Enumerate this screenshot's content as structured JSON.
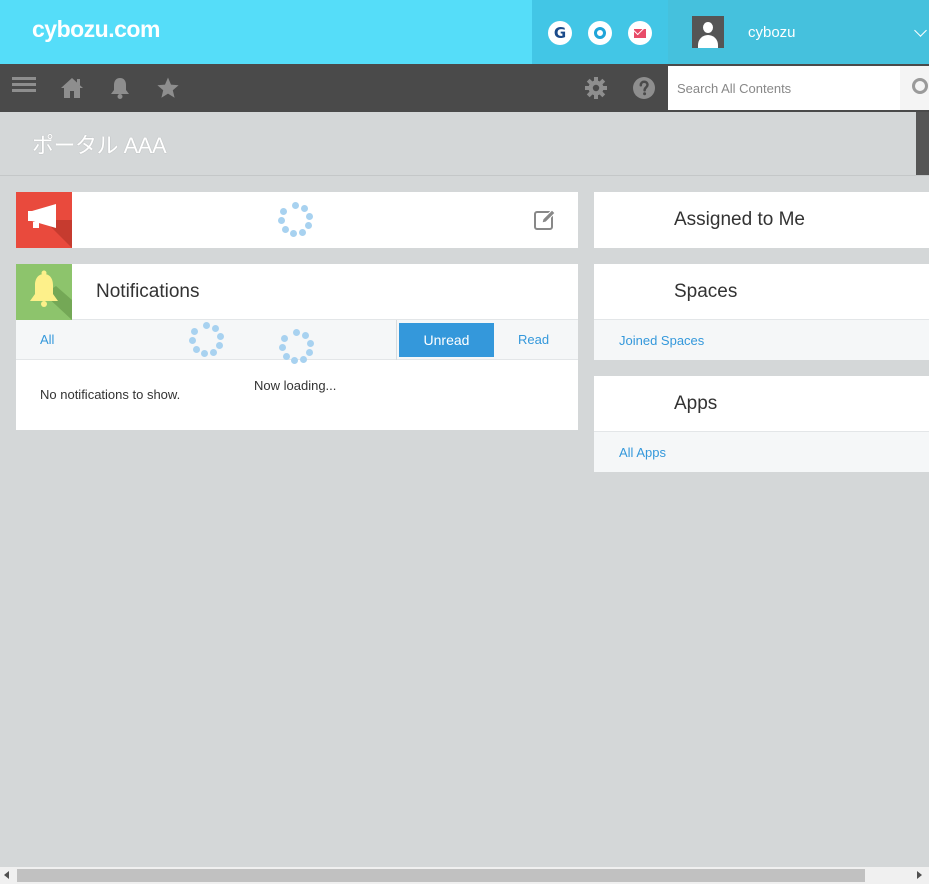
{
  "header": {
    "logo": "cybozu.com",
    "services": [
      {
        "name": "garoon",
        "letter": "G"
      },
      {
        "name": "office",
        "letter": ""
      },
      {
        "name": "mailwise",
        "letter": ""
      }
    ],
    "username": "cybozu"
  },
  "nav": {
    "search_placeholder": "Search All Contents"
  },
  "page": {
    "title": "ポータル AAA"
  },
  "widgets": {
    "notifications": {
      "title": "Notifications",
      "tab_all": "All",
      "tab_unread": "Unread",
      "tab_read": "Read",
      "empty_message": "No notifications to show.",
      "loading_message": "Now loading..."
    },
    "assigned": {
      "title": "Assigned to Me"
    },
    "spaces": {
      "title": "Spaces",
      "link": "Joined Spaces"
    },
    "apps": {
      "title": "Apps",
      "link": "All Apps"
    }
  },
  "colors": {
    "header_bg": "#55ddf9",
    "nav_bg": "#4a4a4a",
    "accent_blue": "#3498db",
    "announcement_red": "#e94a3d",
    "notification_green": "#8dc46c",
    "page_bg": "#d4d7d8"
  }
}
